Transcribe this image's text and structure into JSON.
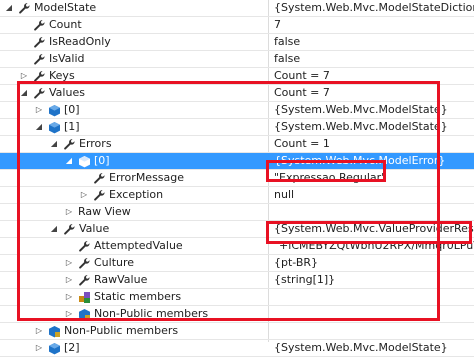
{
  "rows": [
    {
      "name": "ModelState",
      "value": "{System.Web.Mvc.ModelStateDictionary}",
      "depth": 0,
      "expander": "expanded",
      "icon": "wrench"
    },
    {
      "name": "Count",
      "value": "7",
      "depth": 1,
      "expander": "none",
      "icon": "wrench"
    },
    {
      "name": "IsReadOnly",
      "value": "false",
      "depth": 1,
      "expander": "none",
      "icon": "wrench"
    },
    {
      "name": "IsValid",
      "value": "false",
      "depth": 1,
      "expander": "none",
      "icon": "wrench"
    },
    {
      "name": "Keys",
      "value": "Count = 7",
      "depth": 1,
      "expander": "collapsed",
      "icon": "wrench"
    },
    {
      "name": "Values",
      "value": "Count = 7",
      "depth": 1,
      "expander": "expanded",
      "icon": "wrench"
    },
    {
      "name": "[0]",
      "value": "{System.Web.Mvc.ModelState}",
      "depth": 2,
      "expander": "collapsed",
      "icon": "object"
    },
    {
      "name": "[1]",
      "value": "{System.Web.Mvc.ModelState}",
      "depth": 2,
      "expander": "expanded",
      "icon": "object"
    },
    {
      "name": "Errors",
      "value": "Count = 1",
      "depth": 3,
      "expander": "expanded",
      "icon": "wrench"
    },
    {
      "name": "[0]",
      "value": "{System.Web.Mvc.ModelError}",
      "depth": 4,
      "expander": "expanded",
      "icon": "object",
      "selected": true
    },
    {
      "name": "ErrorMessage",
      "value": "\"Expressao Regular\"",
      "depth": 5,
      "expander": "none",
      "icon": "wrench"
    },
    {
      "name": "Exception",
      "value": "null",
      "depth": 5,
      "expander": "collapsed",
      "icon": "wrench"
    },
    {
      "name": "Raw View",
      "value": "",
      "depth": 4,
      "expander": "collapsed",
      "icon": "none"
    },
    {
      "name": "Value",
      "value": "{System.Web.Mvc.ValueProviderResult}",
      "depth": 3,
      "expander": "expanded",
      "icon": "wrench"
    },
    {
      "name": "AttemptedValue",
      "value": "\"+iCMEBYZQtWbnU2RPX/Mmqr0LPuVJz",
      "depth": 4,
      "expander": "none",
      "icon": "wrench"
    },
    {
      "name": "Culture",
      "value": "{pt-BR}",
      "depth": 4,
      "expander": "collapsed",
      "icon": "wrench"
    },
    {
      "name": "RawValue",
      "value": "{string[1]}",
      "depth": 4,
      "expander": "collapsed",
      "icon": "wrench"
    },
    {
      "name": "Static members",
      "value": "",
      "depth": 4,
      "expander": "collapsed",
      "icon": "static"
    },
    {
      "name": "Non-Public members",
      "value": "",
      "depth": 4,
      "expander": "collapsed",
      "icon": "nonpublic"
    },
    {
      "name": "Non-Public members",
      "value": "",
      "depth": 2,
      "expander": "collapsed",
      "icon": "nonpublic"
    },
    {
      "name": "[2]",
      "value": "{System.Web.Mvc.ModelState}",
      "depth": 2,
      "expander": "collapsed",
      "icon": "object"
    }
  ],
  "colors": {
    "highlight": "#e81123",
    "selection": "#3399ff",
    "wrench": "#333333",
    "object": "#1e73c8"
  }
}
